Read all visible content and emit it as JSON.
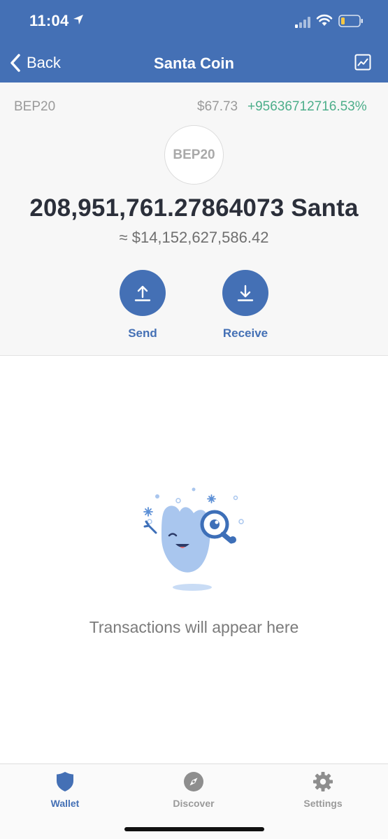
{
  "status_bar": {
    "time": "11:04",
    "icons": [
      "location-arrow-icon",
      "signal-icon",
      "wifi-icon",
      "battery-icon"
    ]
  },
  "nav": {
    "back_label": "Back",
    "title": "Santa Coin",
    "chart_icon": "chart-icon"
  },
  "token": {
    "standard": "BEP20",
    "price": "$67.73",
    "change": "+95636712716.53%",
    "logo_text": "BEP20",
    "balance": "208,951,761.27864073 Santa",
    "fiat_value": "≈ $14,152,627,586.42"
  },
  "actions": {
    "send_label": "Send",
    "receive_label": "Receive"
  },
  "empty_state": {
    "message": "Transactions will appear here",
    "illustration": "mascot-magnifier-illustration"
  },
  "tabbar": {
    "items": [
      {
        "label": "Wallet",
        "icon": "shield-icon",
        "active": true
      },
      {
        "label": "Discover",
        "icon": "compass-icon",
        "active": false
      },
      {
        "label": "Settings",
        "icon": "gear-icon",
        "active": false
      }
    ]
  },
  "colors": {
    "accent": "#4470b5",
    "positive": "#4cae8a",
    "muted": "#9a9a9a",
    "panel": "#f7f7f7"
  }
}
